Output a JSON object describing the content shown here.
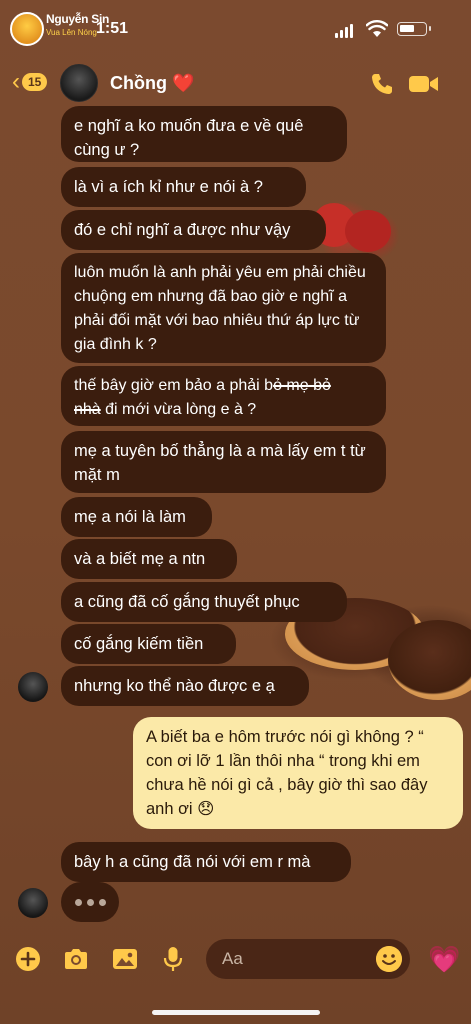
{
  "status_bar": {
    "time": "1:51",
    "watermark_title": "Nguyễn Sin",
    "watermark_sub": "Vua Lên Nóng"
  },
  "header": {
    "back_count": "15",
    "contact_name": "Chồng ❤️",
    "icons": {
      "back": "chevron-left-icon",
      "call": "phone-icon",
      "video": "video-camera-icon"
    }
  },
  "messages": [
    {
      "dir": "in",
      "text": "e nghĩ a ko muốn đưa e về quê cùng ư ?"
    },
    {
      "dir": "in",
      "text": "là vì a ích kỉ như e nói à ?"
    },
    {
      "dir": "in",
      "text": "đó e chỉ nghĩ a được như vậy"
    },
    {
      "dir": "in",
      "text": "luôn muốn là anh phải yêu em phải chiều chuộng em nhưng đã bao giờ e nghĩ a phải đối mặt với bao nhiêu thứ áp lực từ gia đình k ?"
    },
    {
      "dir": "in",
      "pre": "thế bây giờ em bảo a phải b",
      "strike1": "ỏ mẹ bỏ",
      "strike2": "nhà",
      "post": " đi mới vừa lòng e à ?"
    },
    {
      "dir": "in",
      "text": "mẹ a tuyên bố thẳng là a mà lấy em t từ mặt m"
    },
    {
      "dir": "in",
      "text": "mẹ a nói là làm"
    },
    {
      "dir": "in",
      "text": "và a biết mẹ a ntn"
    },
    {
      "dir": "in",
      "text": "a cũng đã cố gắng thuyết phục"
    },
    {
      "dir": "in",
      "text": "cố gắng kiếm tiền"
    },
    {
      "dir": "in",
      "text": "nhưng ko thể nào được e ạ"
    },
    {
      "dir": "out",
      "text": "A biết ba e hôm trước nói gì không ? “ con ơi lỡ 1 lần thôi nha “ trong khi em chưa hề nói gì cả , bây giờ thì sao đây anh ơi 😞"
    },
    {
      "dir": "in",
      "text": "bây h a cũng đã nói với em r mà"
    }
  ],
  "composer": {
    "placeholder": "Aa",
    "icons": [
      "plus-icon",
      "camera-icon",
      "image-icon",
      "microphone-icon",
      "emoji-icon",
      "heart-icon"
    ]
  },
  "colors": {
    "accent": "#ffc94a",
    "incoming_bubble": "#3b1d0e",
    "outgoing_bubble": "#fbe9a8",
    "background": "#7a4a2e"
  }
}
